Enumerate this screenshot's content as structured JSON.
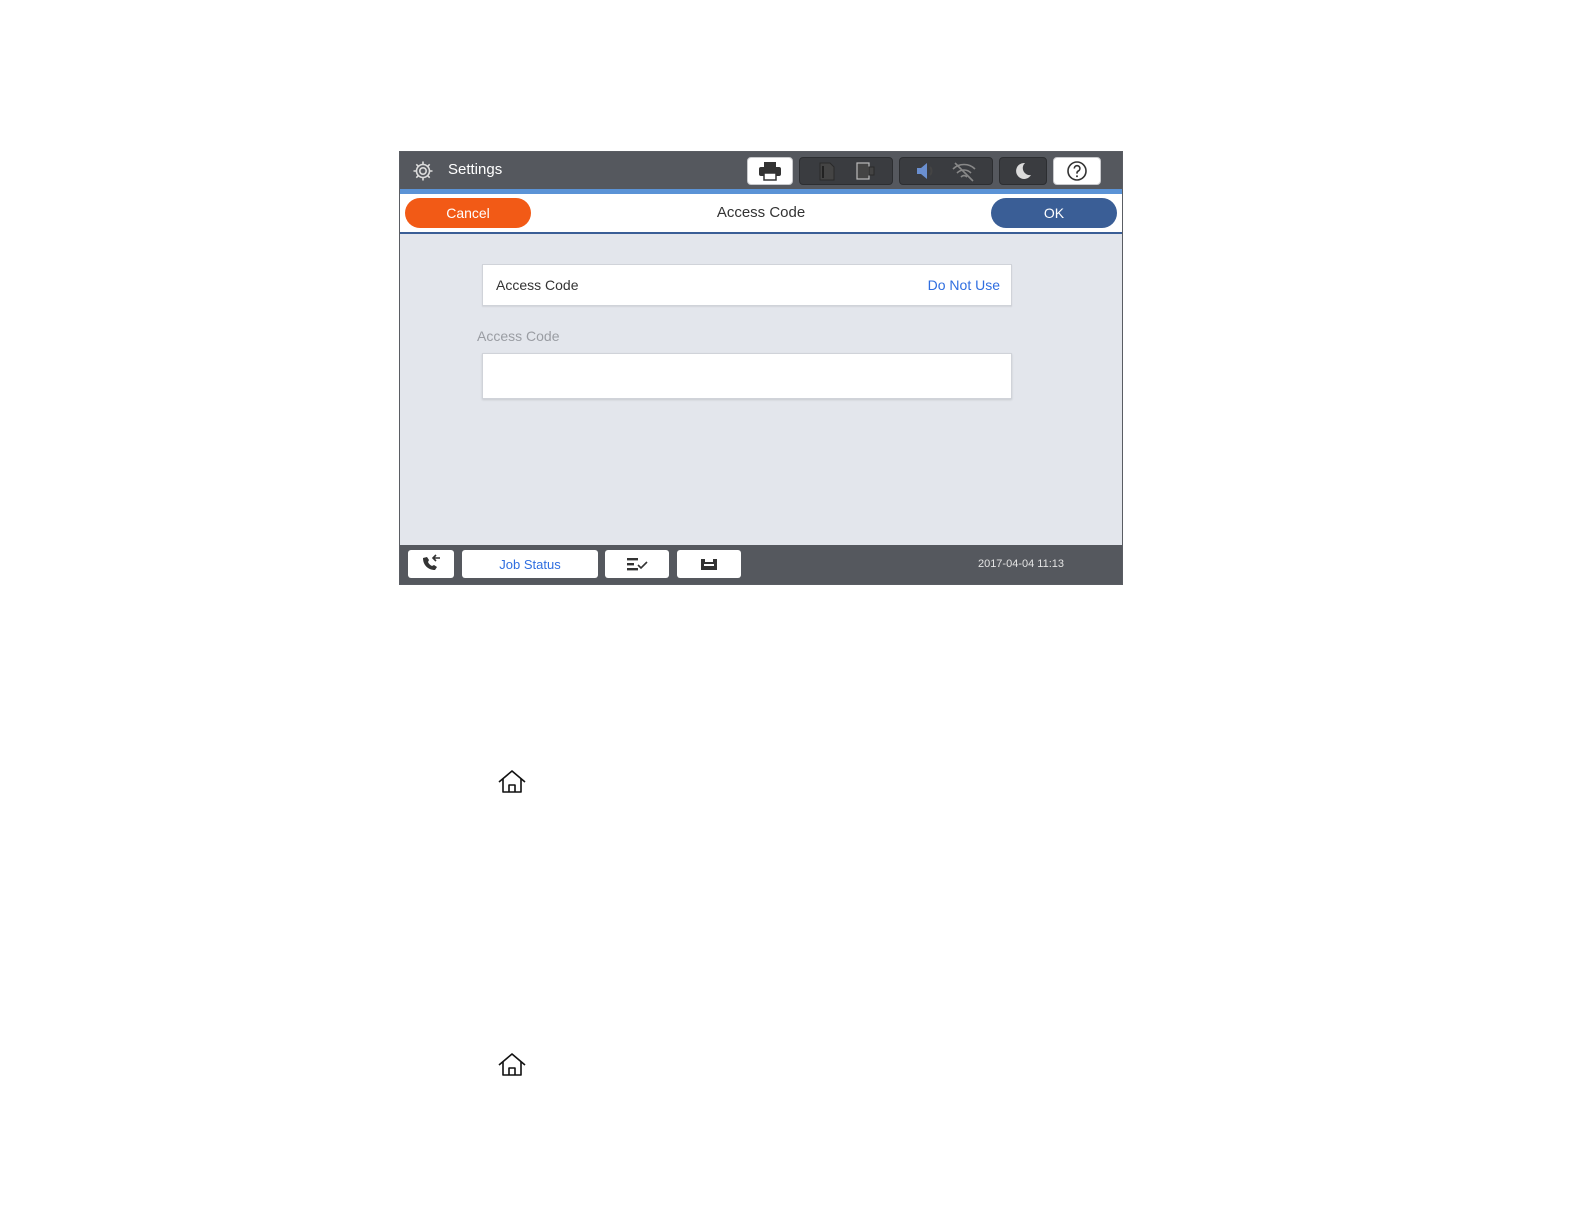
{
  "topbar": {
    "title": "Settings",
    "icons": [
      "gear-icon",
      "printer-icon",
      "sd-card-icon",
      "memory-device-icon",
      "speaker-icon",
      "wifi-off-icon",
      "sleep-moon-icon",
      "help-icon"
    ]
  },
  "header": {
    "cancel_label": "Cancel",
    "title": "Access Code",
    "ok_label": "OK"
  },
  "content": {
    "setting_label": "Access Code",
    "setting_value": "Do Not Use",
    "field_label": "Access Code",
    "field_value": ""
  },
  "bottombar": {
    "job_status_label": "Job Status",
    "datetime": "2017-04-04 11:13",
    "icons": [
      "fax-icon",
      "job-list-icon",
      "tray-icon"
    ]
  },
  "doc_icons": [
    "home-icon",
    "home-icon"
  ],
  "colors": {
    "cancel": "#f25a16",
    "ok": "#3a5e96",
    "link": "#2f6ee0",
    "bar": "#55585e"
  }
}
